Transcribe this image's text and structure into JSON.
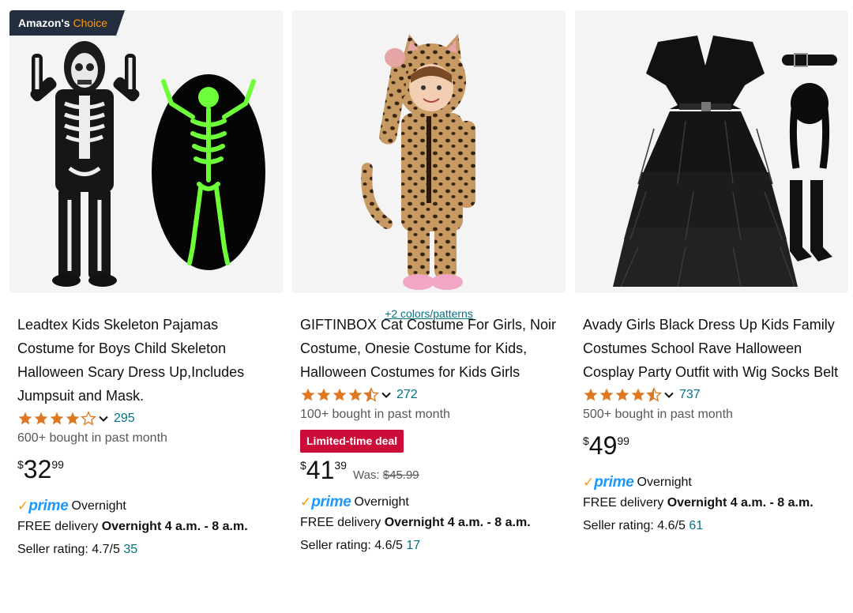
{
  "colors": {
    "star": "#de7921",
    "link": "#007185",
    "deal": "#cc0c39",
    "prime": "#1a98ff",
    "badge": "#232f3e"
  },
  "products": [
    {
      "badge": {
        "prefix": "Amazon's",
        "suffix": "Choice"
      },
      "image_icon": "skeleton-costume-image",
      "title": "Leadtex Kids Skeleton Pajamas Costume for Boys Child Skeleton Halloween Scary Dress Up,Includes Jumpsuit and Mask.",
      "rating": 4.0,
      "rating_count": "295",
      "bought": "600+ bought in past month",
      "price": {
        "symbol": "$",
        "whole": "32",
        "fraction": "99"
      },
      "prime": {
        "check": "✓",
        "label": "prime",
        "speed": "Overnight"
      },
      "delivery": {
        "prefix": "FREE delivery",
        "window": "Overnight 4 a.m. - 8 a.m."
      },
      "seller": {
        "label": "Seller rating: 4.7/5",
        "count": "35"
      }
    },
    {
      "colors_link": "+2 colors/patterns",
      "image_icon": "leopard-costume-image",
      "title": "GIFTINBOX Cat Costume For Girls, Noir Costume, Onesie Costume for Kids, Halloween Costumes for Kids Girls",
      "rating": 4.5,
      "rating_count": "272",
      "bought": "100+ bought in past month",
      "deal": "Limited-time deal",
      "price": {
        "symbol": "$",
        "whole": "41",
        "fraction": "39",
        "was_label": "Was:",
        "was_value": "$45.99"
      },
      "prime": {
        "check": "✓",
        "label": "prime",
        "speed": "Overnight"
      },
      "delivery": {
        "prefix": "FREE delivery",
        "window": "Overnight 4 a.m. - 8 a.m."
      },
      "seller": {
        "label": "Seller rating: 4.6/5",
        "count": "17"
      }
    },
    {
      "image_icon": "black-dress-costume-image",
      "title": "Avady Girls Black Dress Up Kids Family Costumes School Rave Halloween Cosplay Party Outfit with Wig Socks Belt",
      "rating": 4.5,
      "rating_count": "737",
      "bought": "500+ bought in past month",
      "price": {
        "symbol": "$",
        "whole": "49",
        "fraction": "99"
      },
      "prime": {
        "check": "✓",
        "label": "prime",
        "speed": "Overnight"
      },
      "delivery": {
        "prefix": "FREE delivery",
        "window": "Overnight 4 a.m. - 8 a.m."
      },
      "seller": {
        "label": "Seller rating: 4.6/5",
        "count": "61"
      }
    }
  ]
}
